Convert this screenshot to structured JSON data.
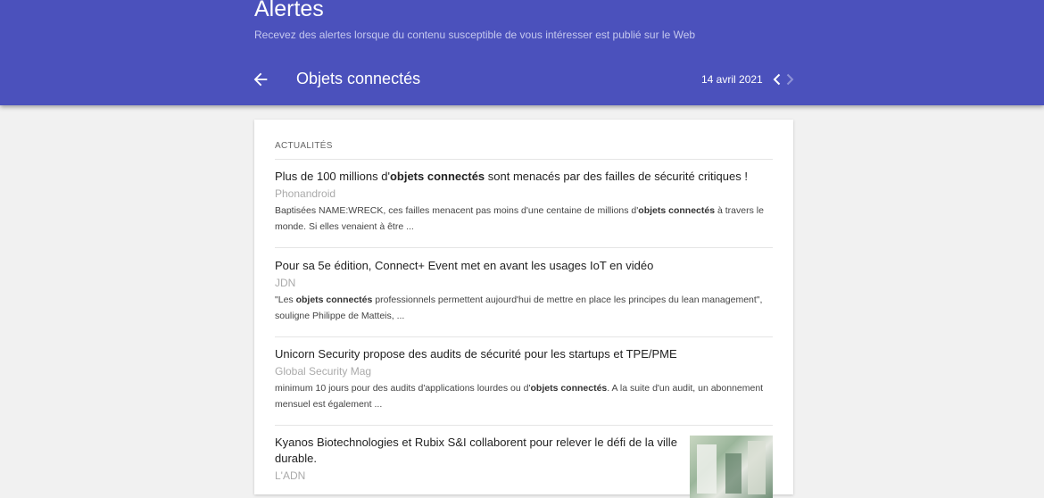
{
  "header": {
    "app_title": "Alertes",
    "subtitle": "Recevez des alertes lorsque du contenu susceptible de vous intéresser est publié sur le Web",
    "alert_name": "Objets connectés",
    "date": "14 avril 2021",
    "icons": {
      "back": "arrow-left-icon",
      "prev": "chevron-left-icon",
      "next": "chevron-right-icon"
    }
  },
  "section": {
    "title": "ACTUALITÉS"
  },
  "articles": [
    {
      "title_before": "Plus de 100 millions d'",
      "title_bold": "objets connectés",
      "title_after": " sont menacés par des failles de sécurité critiques !",
      "source": "Phonandroid",
      "snippet_before": "Baptisées NAME:WRECK, ces failles menacent pas moins d'une centaine de millions d'",
      "snippet_bold": "objets connectés",
      "snippet_after": " à travers le monde. Si elles venaient à être ..."
    },
    {
      "title": "Pour sa 5e édition, Connect+ Event met en avant les usages IoT en vidéo",
      "source": "JDN",
      "snippet_before": "\"Les ",
      "snippet_bold": "objets connectés",
      "snippet_after": " professionnels permettent aujourd'hui de mettre en place les principes du lean management\", souligne Philippe de Matteis, ..."
    },
    {
      "title": "Unicorn Security propose des audits de sécurité pour les startups et TPE/PME",
      "source": "Global Security Mag",
      "snippet_before": "minimum 10 jours pour des audits d'applications lourdes ou d'",
      "snippet_bold": "objets connectés",
      "snippet_after": ". A la suite d'un audit, un abonnement mensuel est également ..."
    },
    {
      "title": "Kyanos Biotechnologies et Rubix S&I collaborent pour relever le défi de la ville durable.",
      "source": "L'ADN"
    }
  ],
  "colors": {
    "header_bg": "#4b51bc",
    "page_bg": "#f1f1f1",
    "card_bg": "#ffffff"
  }
}
